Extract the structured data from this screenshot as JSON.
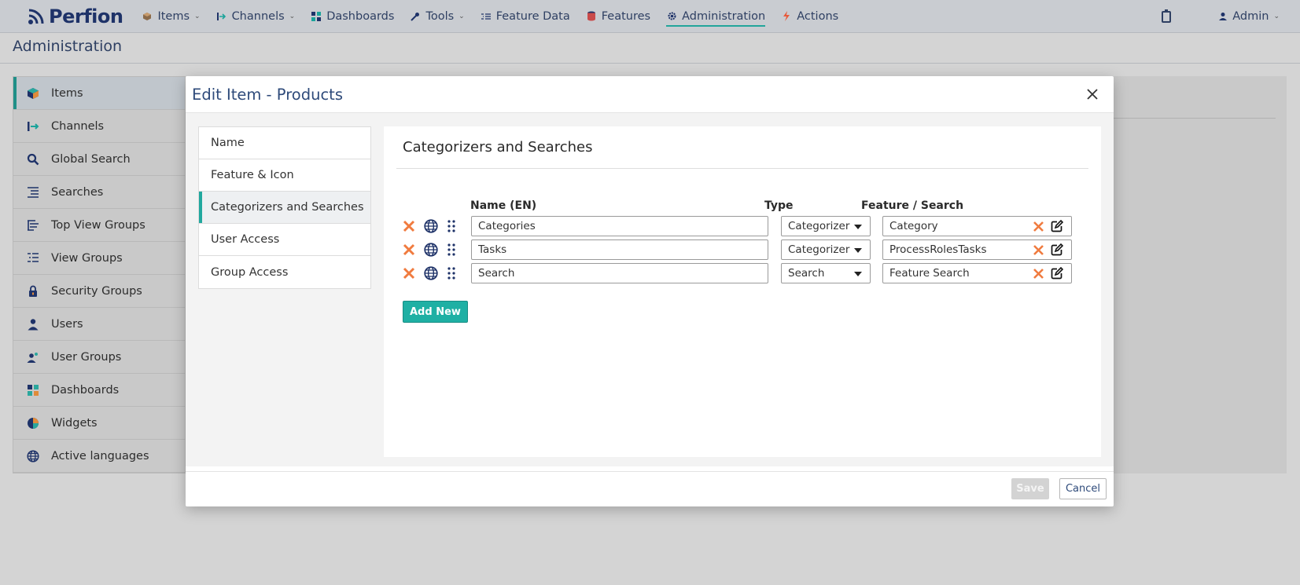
{
  "app": {
    "logo_text": "Perfion"
  },
  "nav": {
    "items": [
      {
        "label": "Items",
        "icon": "cube-icon",
        "dropdown": true
      },
      {
        "label": "Channels",
        "icon": "channel-arrow-icon",
        "dropdown": true
      },
      {
        "label": "Dashboards",
        "icon": "dashboard-grid-icon",
        "dropdown": false
      },
      {
        "label": "Tools",
        "icon": "wrench-icon",
        "dropdown": true
      },
      {
        "label": "Feature Data",
        "icon": "list-icon",
        "dropdown": false
      },
      {
        "label": "Features",
        "icon": "database-icon",
        "dropdown": false
      },
      {
        "label": "Administration",
        "icon": "gear-icon",
        "dropdown": false,
        "active": true
      },
      {
        "label": "Actions",
        "icon": "lightning-icon",
        "dropdown": false
      }
    ],
    "user_label": "Admin"
  },
  "page": {
    "title": "Administration"
  },
  "sidebar": {
    "items": [
      {
        "label": "Items",
        "icon": "cube-icon",
        "active": true
      },
      {
        "label": "Channels",
        "icon": "channel-arrow-icon"
      },
      {
        "label": "Global Search",
        "icon": "search-icon"
      },
      {
        "label": "Searches",
        "icon": "search-list-icon"
      },
      {
        "label": "Top View Groups",
        "icon": "tree-list-icon"
      },
      {
        "label": "View Groups",
        "icon": "view-groups-icon"
      },
      {
        "label": "Security Groups",
        "icon": "lock-icon"
      },
      {
        "label": "Users",
        "icon": "user-icon"
      },
      {
        "label": "User Groups",
        "icon": "user-group-icon"
      },
      {
        "label": "Dashboards",
        "icon": "dashboard-grid-icon"
      },
      {
        "label": "Widgets",
        "icon": "pie-chart-icon"
      },
      {
        "label": "Active languages",
        "icon": "globe-icon"
      }
    ]
  },
  "modal": {
    "title": "Edit Item - Products",
    "tabs": [
      {
        "label": "Name"
      },
      {
        "label": "Feature & Icon"
      },
      {
        "label": "Categorizers and Searches",
        "active": true
      },
      {
        "label": "User Access"
      },
      {
        "label": "Group Access"
      }
    ],
    "section_title": "Categorizers and Searches",
    "columns": {
      "name": "Name (EN)",
      "type": "Type",
      "feature": "Feature / Search"
    },
    "rows": [
      {
        "name": "Categories",
        "type": "Categorizer",
        "feature": "Category"
      },
      {
        "name": "Tasks",
        "type": "Categorizer",
        "feature": "ProcessRolesTasks"
      },
      {
        "name": "Search",
        "type": "Search",
        "feature": "Feature Search"
      }
    ],
    "add_new_label": "Add New",
    "save_label": "Save",
    "cancel_label": "Cancel"
  },
  "colors": {
    "accent": "#21a89e",
    "brand_text": "#1e3268",
    "delete": "#f07b3f",
    "overlay_bg": "#d4d4d4"
  }
}
